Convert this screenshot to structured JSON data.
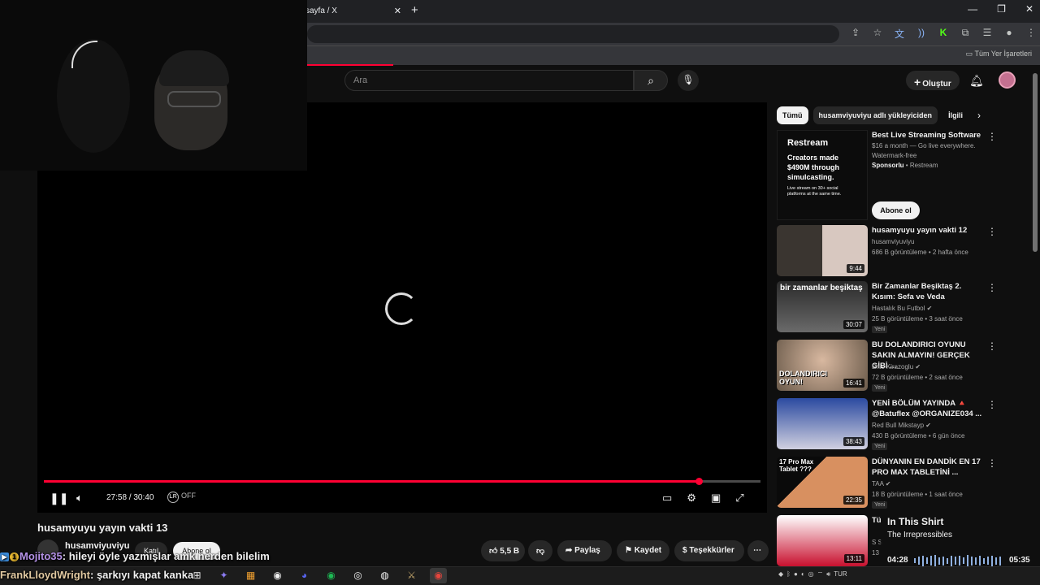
{
  "browser": {
    "tab_title": "sayfa / X",
    "bookmarks_label": "Tüm Yer İşaretleri"
  },
  "header": {
    "search_placeholder": "Ara",
    "create_label": "Oluştur"
  },
  "player": {
    "time": "27:58 / 30:40",
    "lr_label": "OFF",
    "progress_fraction": 0.914
  },
  "video": {
    "title": "husamyuyu yayın vakti 13",
    "channel": "husamviyuviyu",
    "join_label": "Katıl",
    "subscribe_label": "Abone ol",
    "like_count": "5,5 B",
    "share_label": "Paylaş",
    "save_label": "Kaydet",
    "thanks_label": "Teşekkürler"
  },
  "chips": [
    "Tümü",
    "husamviyuviyu adlı yükleyiciden",
    "İlgili"
  ],
  "ad": {
    "brand": "Restream",
    "body": "Creators made $490M through simulcasting.",
    "small": "Live stream on 30+ social platforms at the same time.",
    "title": "Best Live Streaming Software",
    "desc1": "$16 a month — Go live everywhere.",
    "desc2": "Watermark-free",
    "sponsor_label": "Sponsorlu",
    "sponsor_name": "Restream",
    "subscribe_label": "Abone ol"
  },
  "related": [
    {
      "title": "husamyuyu yayın vakti 12",
      "channel": "husamviyuviyu",
      "meta": "686 B görüntüleme • 2 hafta önce",
      "duration": "9:44",
      "new": ""
    },
    {
      "title": "Bir Zamanlar Beşiktaş 2. Kısım: Sefa ve Veda",
      "channel": "Hastalık Bu Futbol",
      "meta": "25 B görüntüleme • 3 saat önce",
      "duration": "30:07",
      "new": "Yeni",
      "thumb_text": "bir zamanlar beşiktaş"
    },
    {
      "title": "BU DOLANDIRICI OYUNU SAKIN ALMAYIN! GERÇEK GİBİ ...",
      "channel": "Enis Kirazoglu",
      "meta": "72 B görüntüleme • 2 saat önce",
      "duration": "16:41",
      "new": "Yeni",
      "thumb_text": "DOLANDIRICI OYUN!"
    },
    {
      "title": "YENİ BÖLÜM YAYINDA 🔺 @Batuflex @ORGANIZE034 ...",
      "channel": "Red Bull Mikstayp",
      "meta": "430 B görüntüleme • 6 gün önce",
      "duration": "38:43",
      "new": "Yeni"
    },
    {
      "title": "DÜNYANIN EN DANDİK EN 17 PRO MAX TABLETİNİ ...",
      "channel": "TAA",
      "meta": "18 B görüntüleme • 1 saat önce",
      "duration": "22:35",
      "new": "Yeni",
      "thumb_text": "17 Pro Max Tablet ???"
    },
    {
      "title": "Tü",
      "channel": "S S",
      "meta": "13",
      "duration": "13:11",
      "new": ""
    }
  ],
  "music": {
    "title": "In This Shirt",
    "artist": "The Irrepressibles",
    "elapsed": "04:28",
    "total": "05:35"
  },
  "chat": [
    {
      "user": "Mojito35",
      "sep": ": ",
      "text": "hileyi öyle yazmışlar amk nerden bilelim"
    },
    {
      "user": "FrankLloydWright",
      "sep": ": ",
      "text": "şarkıyı kapat kanka"
    }
  ],
  "taskbar": {
    "lang": "TUR"
  },
  "colors": {
    "accent": "#ff0033",
    "background": "#0f0f0f"
  }
}
